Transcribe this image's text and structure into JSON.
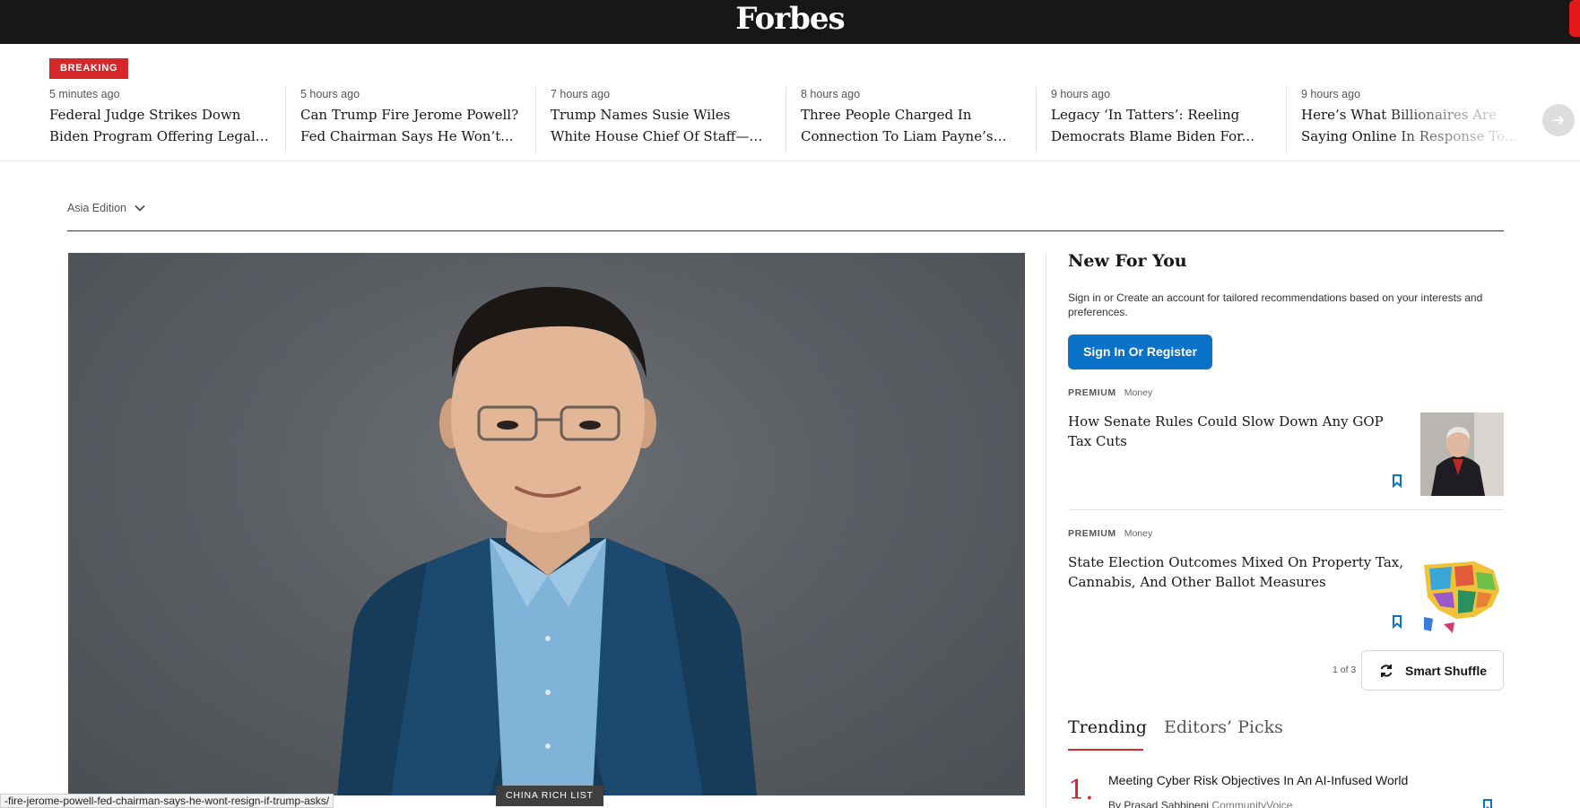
{
  "header": {
    "logo": "Forbes"
  },
  "ticker": {
    "badge": "BREAKING",
    "items": [
      {
        "time": "5 minutes ago",
        "headline": "Federal Judge Strikes Down Biden Program Offering Legal Status T..."
      },
      {
        "time": "5 hours ago",
        "headline": "Can Trump Fire Jerome Powell? Fed Chairman Says He Won’t..."
      },
      {
        "time": "7 hours ago",
        "headline": "Trump Names Susie Wiles White House Chief Of Staff—His First..."
      },
      {
        "time": "8 hours ago",
        "headline": "Three People Charged In Connection To Liam Payne’s Death"
      },
      {
        "time": "9 hours ago",
        "headline": "Legacy ‘In Tatters’: Reeling Democrats Blame Biden For..."
      },
      {
        "time": "9 hours ago",
        "headline": "Here’s What Billionaires Are Saying Online In Response To..."
      }
    ],
    "next_icon": "arrow-right-icon"
  },
  "edition": {
    "label": "Asia Edition",
    "icon": "chevron-down-icon"
  },
  "hero": {
    "tag": "CHINA RICH LIST"
  },
  "status_bar": {
    "url": "-fire-jerome-powell-fed-chairman-says-he-wont-resign-if-trump-asks/"
  },
  "new_for_you": {
    "title": "New For You",
    "description": "Sign in or Create an account for tailored recommendations based on your interests and preferences.",
    "signin_label": "Sign In Or Register",
    "cards": [
      {
        "premium": "PREMIUM",
        "category": "Money",
        "title": "How Senate Rules Could Slow Down Any GOP Tax Cuts"
      },
      {
        "premium": "PREMIUM",
        "category": "Money",
        "title": "State Election Outcomes Mixed On Property Tax, Cannabis, And Other Ballot Measures"
      }
    ],
    "pager": "1 of 3",
    "shuffle_label": "Smart Shuffle"
  },
  "tabs": {
    "trending": "Trending",
    "editors_picks": "Editors’ Picks"
  },
  "trending": [
    {
      "number": "1.",
      "title": "Meeting Cyber Risk Objectives In An AI-Infused World",
      "by": "By Prasad Sabbineni",
      "contributor": "CommunityVoice"
    }
  ],
  "colors": {
    "accent_red": "#d6282b",
    "brand_blue": "#0a72c9",
    "topbar": "#181716"
  }
}
